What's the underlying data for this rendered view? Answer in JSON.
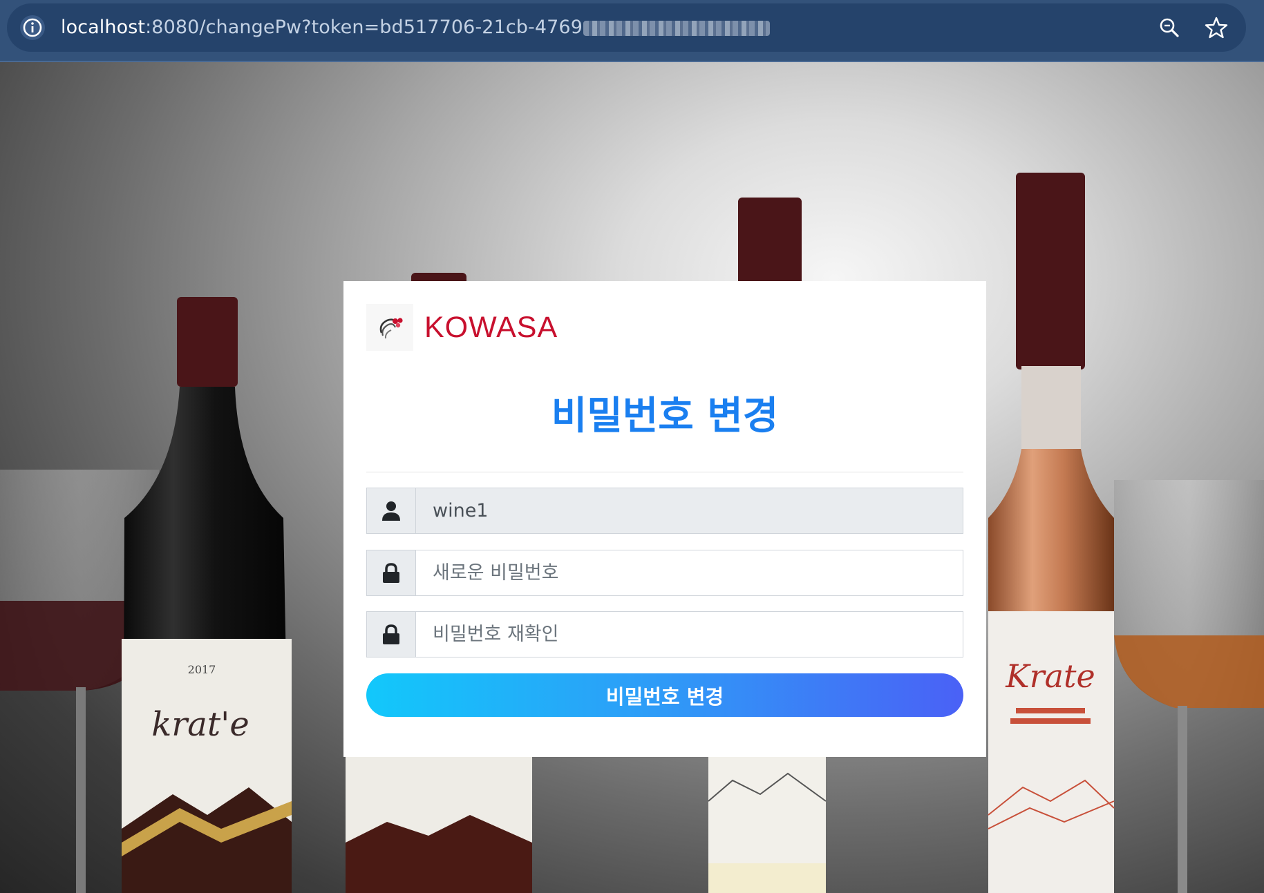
{
  "browser": {
    "url_host": "localhost",
    "url_rest": ":8080/changePw?token=bd517706-21cb-4769",
    "info_icon": "info-icon",
    "zoom_icon": "zoom-icon",
    "bookmark_icon": "star-icon"
  },
  "card": {
    "brand": {
      "logo_icon": "kowasa-logo-icon",
      "name": "KOWASA",
      "color": "#c8102e"
    },
    "title": "비밀번호 변경",
    "title_color": "#1a7ff0",
    "fields": [
      {
        "icon": "user-icon",
        "value": "wine1",
        "placeholder": "",
        "readonly": true
      },
      {
        "icon": "lock-icon",
        "value": "",
        "placeholder": "새로운 비밀번호",
        "readonly": false
      },
      {
        "icon": "lock-icon",
        "value": "",
        "placeholder": "비밀번호 재확인",
        "readonly": false
      }
    ],
    "submit_label": "비밀번호 변경",
    "submit_gradient": [
      "#12c8fb",
      "#4a61f6"
    ]
  }
}
